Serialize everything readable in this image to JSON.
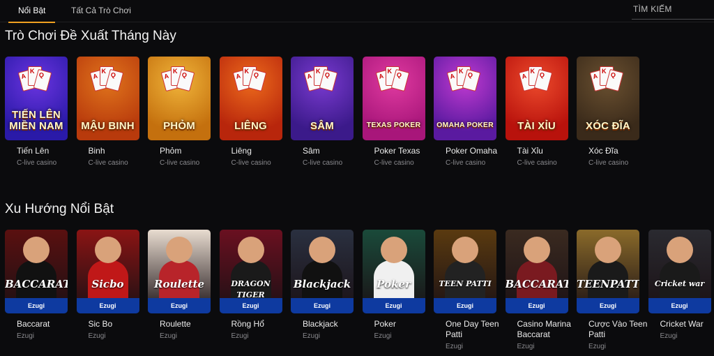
{
  "tabs": [
    {
      "label": "Nổi Bật",
      "active": true
    },
    {
      "label": "Tất Cả Trò Chơi",
      "active": false
    }
  ],
  "search": {
    "label": "TÌM KIẾM"
  },
  "section1": {
    "title": "Trò Chơi Đề Xuất Tháng Này",
    "games": [
      {
        "name": "Tiến Lên",
        "provider": "C-live casino",
        "art": "TIẾN LÊN\nMIỀN NAM",
        "bg": "#2a1aa8",
        "bg2": "#6b34e0"
      },
      {
        "name": "Binh",
        "provider": "C-live casino",
        "art": "MẬU BINH",
        "bg": "#b83a0c",
        "bg2": "#e0741c"
      },
      {
        "name": "Phỏm",
        "provider": "C-live casino",
        "art": "PHỎM",
        "bg": "#c4700e",
        "bg2": "#f0b43a"
      },
      {
        "name": "Liêng",
        "provider": "C-live casino",
        "art": "LIÊNG",
        "bg": "#b8260c",
        "bg2": "#ec6a1c"
      },
      {
        "name": "Sâm",
        "provider": "C-live casino",
        "art": "SÂM",
        "bg": "#3b1a8a",
        "bg2": "#7a3ad0"
      },
      {
        "name": "Poker Texas",
        "provider": "C-live casino",
        "art": "TEXAS POKER",
        "bg": "#a8167a",
        "bg2": "#e03aa0"
      },
      {
        "name": "Poker Omaha",
        "provider": "C-live casino",
        "art": "OMAHA POKER",
        "bg": "#5a1aa0",
        "bg2": "#c03ad0"
      },
      {
        "name": "Tài Xỉu",
        "provider": "C-live casino",
        "art": "TÀI XỈU",
        "bg": "#b8120c",
        "bg2": "#ec4a2c"
      },
      {
        "name": "Xóc Đĩa",
        "provider": "C-live casino",
        "art": "XÓC ĐĨA",
        "bg": "#3a2a1a",
        "bg2": "#6a5030"
      }
    ]
  },
  "section2": {
    "title": "Xu Hướng Nổi Bật",
    "games": [
      {
        "name": "Baccarat",
        "provider": "Ezugi",
        "logo": "BACCARAT",
        "bg": "#5a1010",
        "suit": "#111"
      },
      {
        "name": "Sic Bo",
        "provider": "Ezugi",
        "logo": "Sicbo",
        "bg": "#8a1414",
        "suit": "#c01818"
      },
      {
        "name": "Roulette",
        "provider": "Ezugi",
        "logo": "Roulette",
        "bg": "#e8dcd0",
        "suit": "#b8242a"
      },
      {
        "name": "Rồng Hổ",
        "provider": "Ezugi",
        "logo": "DRAGON TIGER",
        "bg": "#6a1020",
        "suit": "#1a1a1a"
      },
      {
        "name": "Blackjack",
        "provider": "Ezugi",
        "logo": "Blackjack",
        "bg": "#2a3040",
        "suit": "#111"
      },
      {
        "name": "Poker",
        "provider": "Ezugi",
        "logo": "Poker",
        "bg": "#1a4a3a",
        "suit": "#f0f0f0"
      },
      {
        "name": "One Day Teen Patti",
        "provider": "Ezugi",
        "logo": "TEEN PATTI",
        "bg": "#5a3a10",
        "suit": "#222"
      },
      {
        "name": "Casino Marina Baccarat",
        "provider": "Ezugi",
        "logo": "BACCARAT",
        "bg": "#3a2a20",
        "suit": "#7a1a20"
      },
      {
        "name": "Cược Vào Teen Patti",
        "provider": "Ezugi",
        "logo": "TEENPATTI",
        "bg": "#8a6a2a",
        "suit": "#1a1a1a"
      },
      {
        "name": "Cricket War",
        "provider": "Ezugi",
        "logo": "Cricket war",
        "bg": "#2a2a30",
        "suit": "#1a1a1a"
      }
    ]
  },
  "colors": {
    "accent": "#f0a020",
    "band": "#0e3aa0"
  }
}
